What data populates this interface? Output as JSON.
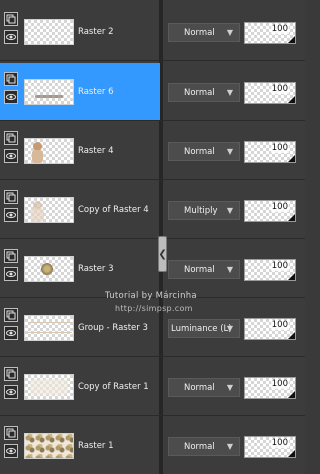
{
  "layers": [
    {
      "name": "Raster 2",
      "blend": "Normal",
      "opacity": "100",
      "selected": false,
      "thumb": "empty"
    },
    {
      "name": "Raster 6",
      "blend": "Normal",
      "opacity": "100",
      "selected": true,
      "thumb": "text"
    },
    {
      "name": "Raster 4",
      "blend": "Normal",
      "opacity": "100",
      "selected": false,
      "thumb": "figure"
    },
    {
      "name": "Copy of Raster 4",
      "blend": "Multiply",
      "opacity": "100",
      "selected": false,
      "thumb": "figure-faint"
    },
    {
      "name": "Raster 3",
      "blend": "Normal",
      "opacity": "100",
      "selected": false,
      "thumb": "ornament"
    },
    {
      "name": "Group - Raster 3",
      "blend": "Luminance (L)",
      "opacity": "100",
      "selected": false,
      "thumb": "group"
    },
    {
      "name": "Copy of Raster 1",
      "blend": "Normal",
      "opacity": "100",
      "selected": false,
      "thumb": "faint"
    },
    {
      "name": "Raster 1",
      "blend": "Normal",
      "opacity": "100",
      "selected": false,
      "thumb": "pattern"
    }
  ],
  "watermark": {
    "line1": "Tutorial by Márcinha",
    "line2": "http://simpsp.com"
  },
  "colors": {
    "selected": "#3399ff",
    "panel": "#3c3c3c",
    "separator": "#262626"
  },
  "icons": {
    "visibility": "eye-icon",
    "layer_type": "raster-layer-icon",
    "dropdown": "chevron-down-icon",
    "splitter": "splitter-handle-icon"
  }
}
